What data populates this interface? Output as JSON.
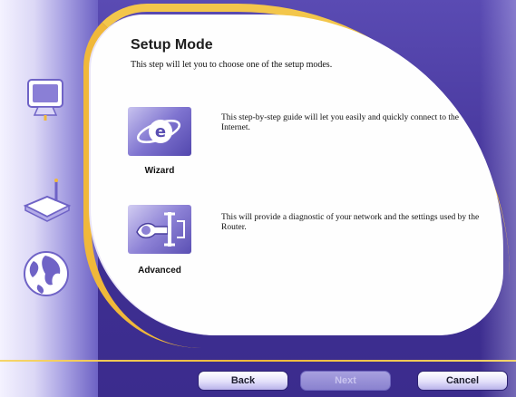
{
  "setup": {
    "title": "Setup Mode",
    "subtitle": "This step will let you to choose one of the setup modes."
  },
  "options": [
    {
      "label": "Wizard",
      "icon": "wizard-e-icon",
      "description": "This step-by-step guide will let you easily and quickly connect to the Internet."
    },
    {
      "label": "Advanced",
      "icon": "advanced-tools-icon",
      "description": "This will provide a diagnostic of your network and the settings used by the Router."
    }
  ],
  "sidebar": {
    "icons": [
      "monitor-icon",
      "router-icon",
      "globe-icon"
    ]
  },
  "buttons": {
    "back": "Back",
    "next": "Next",
    "cancel": "Cancel"
  },
  "colors": {
    "frame": "#4a3a9e",
    "accent_yellow": "#f0b83a",
    "panel": "#fefefe"
  }
}
